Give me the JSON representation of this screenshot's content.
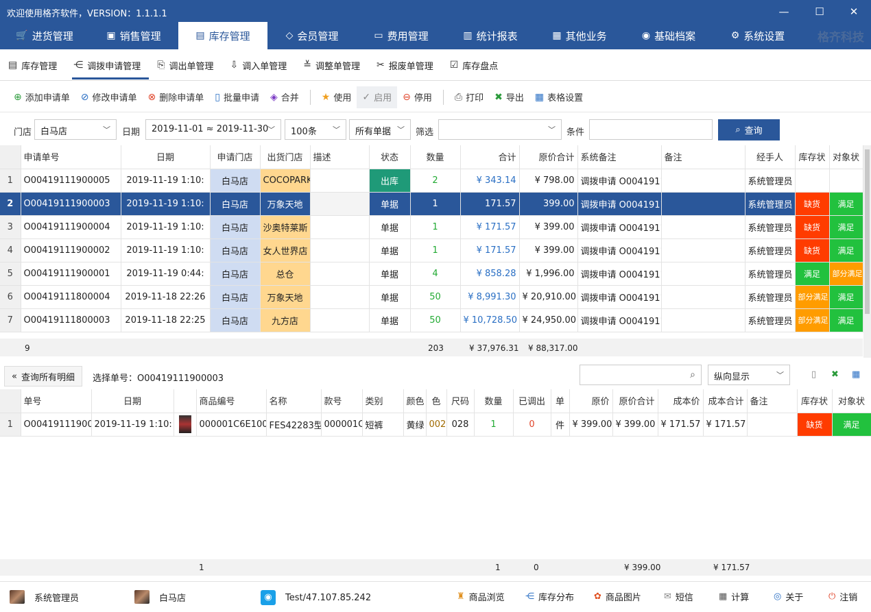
{
  "window": {
    "title": "欢迎使用格齐软件，VERSION：1.1.1.1",
    "min": "—",
    "max": "☐",
    "close": "✕"
  },
  "brand": "格齐科技",
  "menu": [
    {
      "label": "进货管理",
      "icon": "cart-icon"
    },
    {
      "label": "销售管理",
      "icon": "sales-icon"
    },
    {
      "label": "库存管理",
      "icon": "inventory-icon",
      "active": true
    },
    {
      "label": "会员管理",
      "icon": "diamond-icon"
    },
    {
      "label": "费用管理",
      "icon": "money-icon"
    },
    {
      "label": "统计报表",
      "icon": "report-icon"
    },
    {
      "label": "其他业务",
      "icon": "grid-icon"
    },
    {
      "label": "基础档案",
      "icon": "location-icon"
    },
    {
      "label": "系统设置",
      "icon": "gear-icon"
    }
  ],
  "subnav": [
    "库存管理",
    "调拨申请管理",
    "调出单管理",
    "调入单管理",
    "调整单管理",
    "报废单管理",
    "库存盘点"
  ],
  "toolbar": [
    "添加申请单",
    "修改申请单",
    "删除申请单",
    "批量申请",
    "合并",
    "使用",
    "启用",
    "停用",
    "打印",
    "导出",
    "表格设置"
  ],
  "filter": {
    "store_label": "门店",
    "store": "白马店",
    "date_label": "日期",
    "date": "2019-11-01 ≈ 2019-11-30",
    "count": "100条",
    "type": "所有单据",
    "screen_label": "筛选",
    "screen": "",
    "cond_label": "条件",
    "cond": "",
    "query": "查询"
  },
  "grid1": {
    "headers": [
      "申请单号",
      "日期",
      "申请门店",
      "出货门店",
      "描述",
      "状态",
      "数量",
      "合计",
      "原价合计",
      "系统备注",
      "备注",
      "经手人",
      "库存状",
      "对象状"
    ],
    "rows": [
      {
        "n": "1",
        "id": "O00419111900005",
        "date": "2019-11-19 1:10:",
        "store": "白马店",
        "ostore": "COCOPARK",
        "desc": "",
        "status": "出库",
        "qty": "2",
        "total": "¥ 343.14",
        "orig": "¥ 798.00",
        "sysnote": "调拨申请 O0041911",
        "note": "",
        "handler": "系统管理员",
        "stock": "",
        "obj": ""
      },
      {
        "n": "2",
        "id": "O00419111900003",
        "date": "2019-11-19 1:10:",
        "store": "白马店",
        "ostore": "万象天地",
        "desc": "",
        "status": "单据",
        "qty": "1",
        "total": "171.57",
        "orig": "399.00",
        "sysnote": "调拨申请 O0041911",
        "note": "",
        "handler": "系统管理员",
        "stock": "缺货",
        "obj": "满足"
      },
      {
        "n": "3",
        "id": "O00419111900004",
        "date": "2019-11-19 1:10:",
        "store": "白马店",
        "ostore": "沙奥特莱斯",
        "desc": "",
        "status": "单据",
        "qty": "1",
        "total": "¥ 171.57",
        "orig": "¥ 399.00",
        "sysnote": "调拨申请 O0041911",
        "note": "",
        "handler": "系统管理员",
        "stock": "缺货",
        "obj": "满足"
      },
      {
        "n": "4",
        "id": "O00419111900002",
        "date": "2019-11-19 1:10:",
        "store": "白马店",
        "ostore": "女人世界店",
        "desc": "",
        "status": "单据",
        "qty": "1",
        "total": "¥ 171.57",
        "orig": "¥ 399.00",
        "sysnote": "调拨申请 O0041911",
        "note": "",
        "handler": "系统管理员",
        "stock": "缺货",
        "obj": "满足"
      },
      {
        "n": "5",
        "id": "O00419111900001",
        "date": "2019-11-19 0:44:",
        "store": "白马店",
        "ostore": "总仓",
        "desc": "",
        "status": "单据",
        "qty": "4",
        "total": "¥ 858.28",
        "orig": "¥ 1,996.00",
        "sysnote": "调拨申请 O0041911",
        "note": "",
        "handler": "系统管理员",
        "stock": "满足",
        "obj": "部分满足"
      },
      {
        "n": "6",
        "id": "O00419111800004",
        "date": "2019-11-18 22:26",
        "store": "白马店",
        "ostore": "万象天地",
        "desc": "",
        "status": "单据",
        "qty": "50",
        "total": "¥ 8,991.30",
        "orig": "¥ 20,910.00",
        "sysnote": "调拨申请 O0041911",
        "note": "",
        "handler": "系统管理员",
        "stock": "部分满足",
        "obj": "满足"
      },
      {
        "n": "7",
        "id": "O00419111800003",
        "date": "2019-11-18 22:25",
        "store": "白马店",
        "ostore": "九方店",
        "desc": "",
        "status": "单据",
        "qty": "50",
        "total": "¥ 10,728.50",
        "orig": "¥ 24,950.00",
        "sysnote": "调拨申请 O0041911",
        "note": "",
        "handler": "系统管理员",
        "stock": "部分满足",
        "obj": "满足"
      }
    ],
    "sum": {
      "count": "9",
      "qty": "203",
      "total": "¥ 37,976.31",
      "orig": "¥ 88,317.00"
    }
  },
  "detail": {
    "query_all": "查询所有明细",
    "selected": "选择单号：O00419111900003",
    "search": "",
    "view": "纵向显示"
  },
  "grid2": {
    "headers": [
      "单号",
      "日期",
      "",
      "商品编号",
      "名称",
      "款号",
      "类别",
      "颜色",
      "色",
      "尺码",
      "数量",
      "已调出",
      "单",
      "原价",
      "原价合计",
      "成本价",
      "成本合计",
      "备注",
      "库存状",
      "对象状"
    ],
    "rows": [
      {
        "n": "1",
        "id": "O004191119000",
        "date": "2019-11-19 1:10:",
        "code": "000001C6E1002",
        "name": "FES42283型",
        "style": "000001C",
        "cat": "短裤",
        "color": "黄绿",
        "c": "002",
        "size": "028",
        "qty": "1",
        "out": "0",
        "unit": "件",
        "price": "¥ 399.00",
        "ptotal": "¥ 399.00",
        "cost": "¥ 171.57",
        "ctotal": "¥ 171.57",
        "note": "",
        "stock": "缺货",
        "obj": "满足"
      }
    ],
    "sum": {
      "one": "1",
      "qty": "1",
      "out": "0",
      "ptotal": "¥ 399.00",
      "ctotal": "¥ 171.57"
    }
  },
  "status": {
    "user": "系统管理员",
    "store": "白马店",
    "server": "Test/47.107.85.242",
    "links": [
      "商品浏览",
      "库存分布",
      "商品图片",
      "短信",
      "计算",
      "关于",
      "注销"
    ]
  }
}
